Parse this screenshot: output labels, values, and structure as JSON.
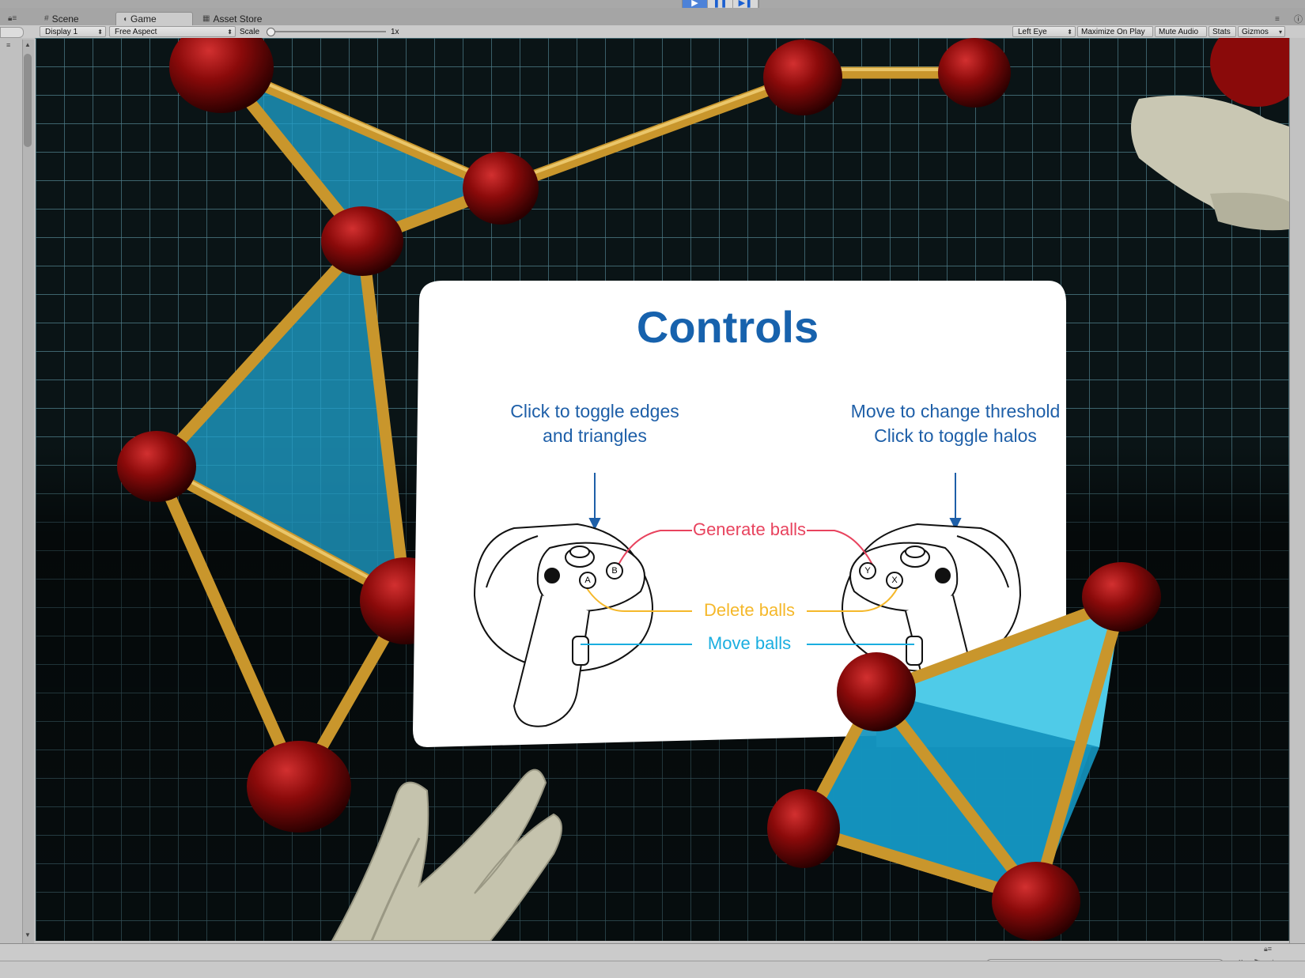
{
  "tabs": [
    {
      "label": "Scene",
      "icon": "grid-icon"
    },
    {
      "label": "Game",
      "icon": "pacman-icon"
    },
    {
      "label": "Asset Store",
      "icon": "store-icon"
    }
  ],
  "toolbar": {
    "display": "Display 1",
    "aspect": "Free Aspect",
    "scale_label": "Scale",
    "scale_value": "1x",
    "eye": "Left Eye",
    "maximize": "Maximize On Play",
    "mute": "Mute Audio",
    "stats": "Stats",
    "gizmos": "Gizmos"
  },
  "panel": {
    "title": "Controls",
    "left_caption_line1": "Click to toggle edges",
    "left_caption_line2": "and triangles",
    "right_caption_line1": "Move to change threshold",
    "right_caption_line2": "Click to toggle halos",
    "generate": "Generate balls",
    "delete": "Delete balls",
    "move": "Move balls",
    "btn_a": "A",
    "btn_b": "B",
    "btn_x": "X",
    "btn_y": "Y"
  },
  "colors": {
    "title_blue": "#1762ad",
    "caption_blue": "#1e5fa8",
    "generate_red": "#e8435e",
    "delete_yellow": "#f5b82a",
    "move_cyan": "#1aaee0",
    "ball_red": "#8a0a0a",
    "rod_gold": "#d9a83a",
    "triangle_cyan": "#1fa3cf"
  }
}
